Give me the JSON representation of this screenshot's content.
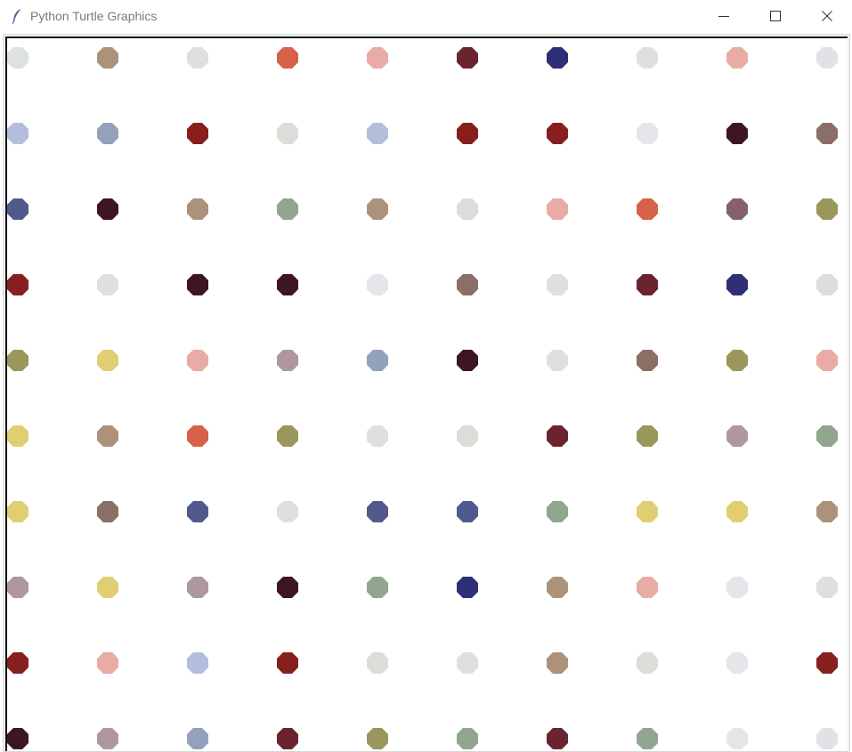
{
  "window": {
    "title": "Python Turtle Graphics"
  },
  "icons": {
    "app": "feather-icon",
    "minimize": "minimize-icon",
    "maximize": "maximize-icon",
    "close": "close-icon"
  },
  "canvas": {
    "background": "#ffffff",
    "dot_grid": [
      [
        "#dde2df",
        "#ad927b",
        "#dfdfdf",
        "#d6624a",
        "#e8aba5",
        "#6b2330",
        "#2f2f78",
        "#dfdfdf",
        "#e8aba5",
        "#e2e2e6"
      ],
      [
        "#b3bedd",
        "#93a1bb",
        "#871f1f",
        "#dcdcd8",
        "#b3bedd",
        "#871f1f",
        "#871f1f",
        "#e5e5ea",
        "#3e1522",
        "#8b6f67"
      ],
      [
        "#515a8d",
        "#3e1522",
        "#ad927b",
        "#91a58f",
        "#ad927b",
        "#dcdcd8",
        "#e8aba5",
        "#d6624a",
        "#85626b",
        "#9b965b"
      ],
      [
        "#871f1f",
        "#dfdfdf",
        "#3e1522",
        "#3e1522",
        "#e5e5ea",
        "#8b6f67",
        "#dfdfdf",
        "#6b2330",
        "#2f2f78",
        "#dddddb"
      ],
      [
        "#9b965b",
        "#e0cf72",
        "#e8aba5",
        "#ae979f",
        "#93a1bb",
        "#3e1522",
        "#dfdfdf",
        "#8b6f67",
        "#9b965b",
        "#e8aba5"
      ],
      [
        "#e0cf72",
        "#ad927b",
        "#d6624a",
        "#9b965b",
        "#dfdfdf",
        "#dcdcd8",
        "#6b2330",
        "#9b965b",
        "#ae979f",
        "#91a58f"
      ],
      [
        "#e0cf72",
        "#8b6f67",
        "#515a8d",
        "#dfdfdf",
        "#515a8d",
        "#515a8d",
        "#91a58f",
        "#e0cf72",
        "#e0cf72",
        "#ad927b"
      ],
      [
        "#ae979f",
        "#e0cf72",
        "#ae979f",
        "#3e1522",
        "#91a58f",
        "#2f2f78",
        "#ad927b",
        "#e8aba5",
        "#e5e5ea",
        "#dfdfdf"
      ],
      [
        "#871f1f",
        "#e8aba5",
        "#b3bedd",
        "#871f1f",
        "#dcdcd8",
        "#dfdfdf",
        "#ad927b",
        "#dcdcd8",
        "#e5e5ea",
        "#871f1f"
      ],
      [
        "#3e1522",
        "#ae979f",
        "#93a1bb",
        "#6b2330",
        "#9b965b",
        "#91a58f",
        "#6b2330",
        "#91a58f",
        "#e5e5ea",
        "#e2e2e6"
      ]
    ]
  }
}
